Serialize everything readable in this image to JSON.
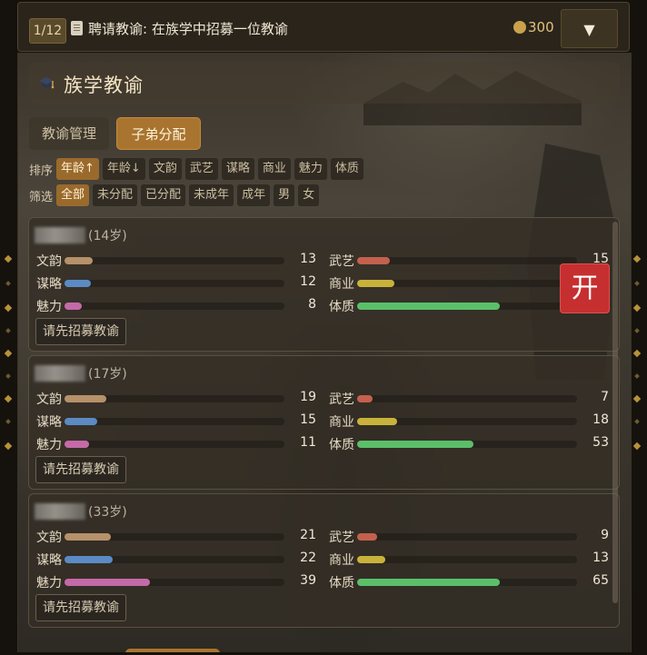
{
  "topbar": {
    "step": "1/12",
    "task": "聘请教谕: 在族学中招募一位教谕",
    "coins": "300",
    "dropdown_icon": "▼"
  },
  "panel": {
    "title": "族学教谕",
    "tabs": [
      {
        "label": "教谕管理",
        "active": false
      },
      {
        "label": "子弟分配",
        "active": true
      }
    ],
    "sort": {
      "label": "排序",
      "options": [
        "年龄↑",
        "年龄↓",
        "文韵",
        "武艺",
        "谋略",
        "商业",
        "魅力",
        "体质"
      ],
      "active": "年龄↑"
    },
    "filter": {
      "label": "筛选",
      "options": [
        "全部",
        "未分配",
        "已分配",
        "未成年",
        "成年",
        "男",
        "女"
      ],
      "active": "全部"
    },
    "open_badge": "开",
    "stat_max": 100,
    "students": [
      {
        "age": "(14岁)",
        "stats": {
          "文韵": 13,
          "武艺": 15,
          "谋略": 12,
          "商业": 17,
          "魅力": 8,
          "体质": 65
        },
        "button": "请先招募教谕"
      },
      {
        "age": "(17岁)",
        "stats": {
          "文韵": 19,
          "武艺": 7,
          "谋略": 15,
          "商业": 18,
          "魅力": 11,
          "体质": 53
        },
        "button": "请先招募教谕"
      },
      {
        "age": "(33岁)",
        "stats": {
          "文韵": 21,
          "武艺": 9,
          "谋略": 22,
          "商业": 13,
          "魅力": 39,
          "体质": 65
        },
        "button": "请先招募教谕"
      }
    ]
  },
  "colors": {
    "accent": "#a9742f",
    "open_badge": "#c62f2f",
    "bar_wenyun": "#b6916a",
    "bar_wuyi": "#c3614e",
    "bar_moulue": "#5b8ac4",
    "bar_shangye": "#c9b23b",
    "bar_meili": "#c46aa8",
    "bar_tizhi": "#5bbf6a"
  }
}
